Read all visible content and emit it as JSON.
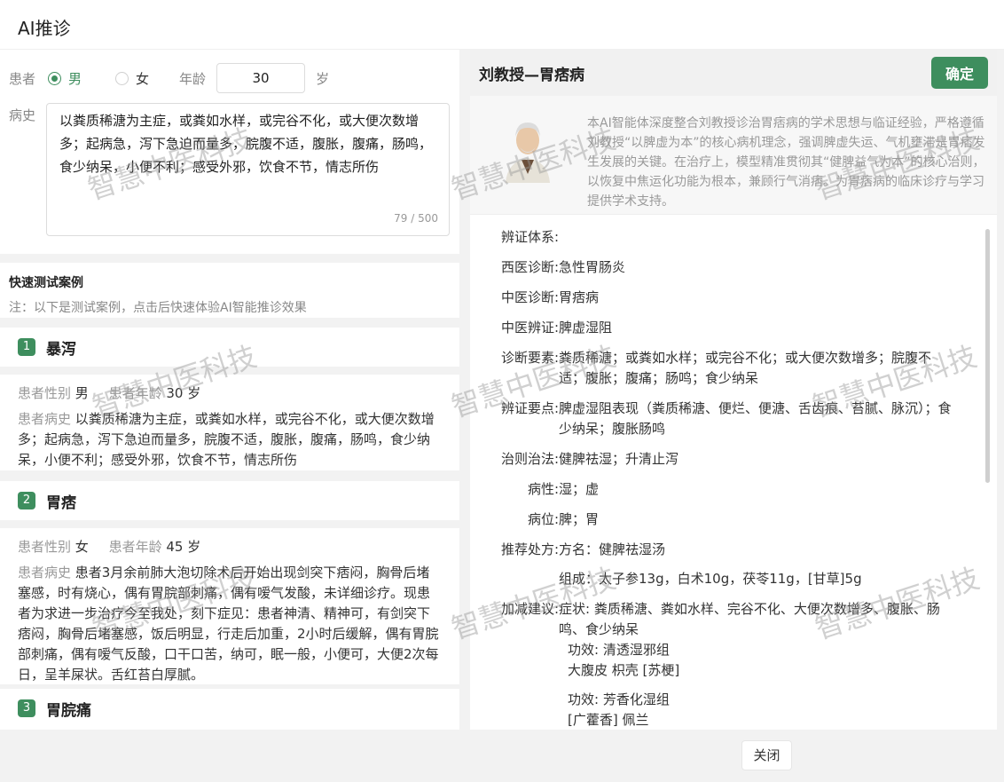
{
  "window": {
    "title": "AI推诊"
  },
  "form": {
    "patient_label": "患者",
    "male_label": "男",
    "female_label": "女",
    "selected_gender": "男",
    "age_label": "年龄",
    "age_value": "30",
    "age_unit": "岁",
    "history_label": "病史",
    "history_text": "以粪质稀溏为主症，或粪如水样，或完谷不化，或大便次数增多；起病急，泻下急迫而量多，脘腹不适，腹胀，腹痛，肠鸣，食少纳呆，小便不利；感受外邪，饮食不节，情志所伤",
    "char_count": "79 / 500"
  },
  "quick": {
    "title": "快速测试案例",
    "note": "注：以下是测试案例，点击后快速体验AI智能推诊效果"
  },
  "cases": [
    {
      "num": "1",
      "title": "暴泻",
      "gender_label": "患者性别",
      "gender": "男",
      "age_label": "患者年龄",
      "age": "30",
      "age_unit": "岁",
      "history_label": "患者病史",
      "history": "以粪质稀溏为主症，或粪如水样，或完谷不化，或大便次数增多；起病急，泻下急迫而量多，脘腹不适，腹胀，腹痛，肠鸣，食少纳呆，小便不利；感受外邪，饮食不节，情志所伤"
    },
    {
      "num": "2",
      "title": "胃痞",
      "gender_label": "患者性别",
      "gender": "女",
      "age_label": "患者年龄",
      "age": "45",
      "age_unit": "岁",
      "history_label": "患者病史",
      "history": "患者3月余前肺大泡切除术后开始出现剑突下痞闷，胸骨后堵塞感，时有烧心，偶有胃脘部刺痛，偶有嗳气发酸，未详细诊疗。现患者为求进一步治疗今至我处，刻下症见：患者神清、精神可，有剑突下痞闷，胸骨后堵塞感，饭后明显，行走后加重，2小时后缓解，偶有胃脘部刺痛，偶有嗳气反酸，口干口苦，纳可，眠一般，小便可，大便2次每日，呈羊屎状。舌红苔白厚腻。"
    },
    {
      "num": "3",
      "title": "胃脘痛"
    }
  ],
  "panel": {
    "title": "刘教授—胃痞病",
    "confirm_label": "确定",
    "intro": "本AI智能体深度整合刘教授诊治胃痞病的学术思想与临证经验，严格遵循刘教授“以脾虚为本”的核心病机理念，强调脾虚失运、气机壅滞是胃痞发生发展的关键。在治疗上，模型精准贯彻其“健脾益气为本”的核心治则，以恢复中焦运化功能为根本，兼顾行气消痞。为胃痞病的临床诊疗与学习提供学术支持。",
    "results": [
      {
        "key": "辨证体系:",
        "val": ""
      },
      {
        "key": "西医诊断:",
        "val": "急性胃肠炎"
      },
      {
        "key": "中医诊断:",
        "val": "胃痞病"
      },
      {
        "key": "中医辨证:",
        "val": "脾虚湿阻"
      },
      {
        "key": "诊断要素:",
        "val": "粪质稀溏；或粪如水样；或完谷不化；或大便次数增多；脘腹不适；腹胀；腹痛；肠鸣；食少纳呆"
      },
      {
        "key": "辨证要点:",
        "val": "脾虚湿阻表现（粪质稀溏、便烂、便溏、舌齿痕、苔腻、脉沉）；食少纳呆；腹胀肠鸣"
      },
      {
        "key": "治则治法:",
        "val": "健脾祛湿；升清止泻"
      },
      {
        "key": "病性:",
        "val": "湿；虚"
      },
      {
        "key": "病位:",
        "val": "脾；胃"
      }
    ],
    "prescription_key": "推荐处方:",
    "prescription_name": "方名：健脾祛湿汤",
    "prescription_comp": "组成：太子参13g，白术10g，茯苓11g，[甘草]5g",
    "modify_key": "加减建议:",
    "modify_symptom": "症状: 粪质稀溏、粪如水样、完谷不化、大便次数增多、腹胀、肠鸣、食少纳呆",
    "modify_effect1": "功效: 清透湿邪组",
    "modify_herbs1": "大腹皮  枳壳  [苏梗]",
    "modify_effect2": "功效: 芳香化湿组",
    "modify_herbs2": "[广藿香]  佩兰"
  },
  "footer": {
    "close_label": "关闭"
  },
  "watermark": "智慧中医科技",
  "colors": {
    "accent": "#3e8e5e"
  }
}
